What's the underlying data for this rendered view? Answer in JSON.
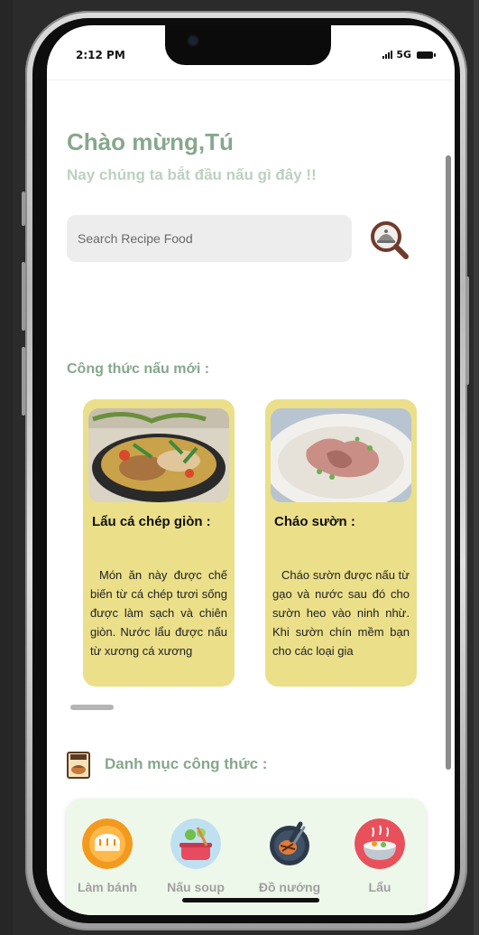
{
  "status_bar": {
    "time": "2:12 PM",
    "network": "5G"
  },
  "header": {
    "greeting": "Chào mừng,Tú",
    "subtitle": "Nay chúng ta bắt đầu nấu gì đây !!"
  },
  "search": {
    "placeholder": "Search Recipe Food",
    "value": ""
  },
  "new_recipes": {
    "title": "Công thức nấu mới :",
    "cards": [
      {
        "title": "Lẩu cá chép giòn :",
        "description": "Món ăn này được chế biến từ cá chép tươi sống được làm sạch và chiên giòn. Nước lẩu được nấu từ xương cá xương",
        "image_icon": "hotpot-photo"
      },
      {
        "title": "Cháo sườn :",
        "description": "Cháo sườn được nấu từ gạo và nước sau đó cho sườn heo vào ninh nhừ. Khi sườn chín mềm bạn cho các loại gia",
        "image_icon": "porridge-photo"
      }
    ]
  },
  "categories": {
    "title": "Danh mục công thức :",
    "items": [
      {
        "label": "Làm bánh",
        "icon": "baking-icon"
      },
      {
        "label": "Nấu soup",
        "icon": "soup-icon"
      },
      {
        "label": "Đồ nướng",
        "icon": "grill-icon"
      },
      {
        "label": "Lẩu",
        "icon": "hotpot-icon"
      }
    ]
  },
  "colors": {
    "accent_green": "#86a88c",
    "card_yellow": "#ebdf8a",
    "category_bg": "#eef8ea"
  }
}
